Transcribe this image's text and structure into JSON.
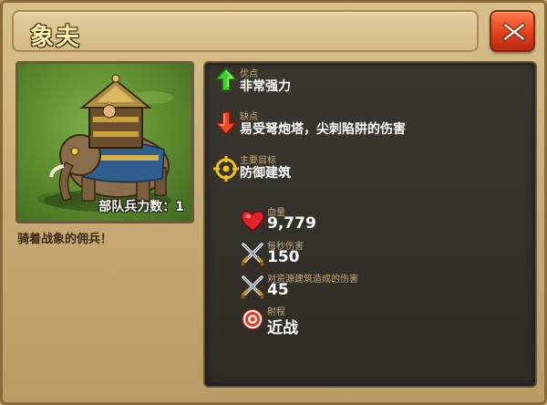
{
  "title": "象夫",
  "portrait": {
    "troop_count_label": "部队兵力数：1"
  },
  "description": "骑着战象的佣兵！",
  "traits": {
    "pros": {
      "label": "优点",
      "value": "非常强力"
    },
    "cons": {
      "label": "缺点",
      "value": "易受弩炮塔，尖刺陷阱的伤害"
    },
    "target": {
      "label": "主要目标",
      "value": "防御建筑"
    }
  },
  "stats": {
    "hp": {
      "label": "血量",
      "value": "9,779",
      "icon": "heart-icon"
    },
    "dps": {
      "label": "每秒伤害",
      "value": "150",
      "icon": "crossed-swords-icon"
    },
    "resource_damage": {
      "label": "对资源建筑造成的伤害",
      "value": "45",
      "icon": "crossed-swords-icon"
    },
    "range": {
      "label": "射程",
      "value": "近战",
      "icon": "range-target-icon"
    }
  },
  "colors": {
    "label": "#c9a974",
    "value": "#ffffff",
    "panel": "#33302a",
    "close_button": "#e2401c"
  }
}
